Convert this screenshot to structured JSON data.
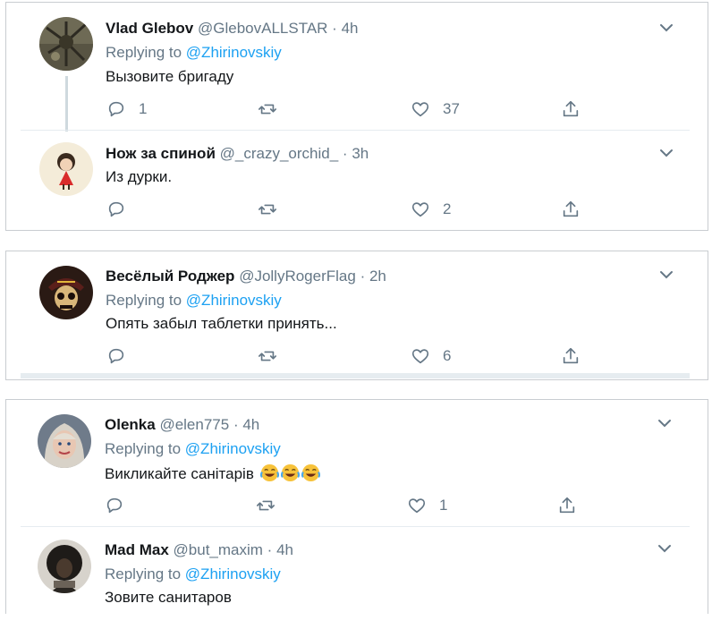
{
  "colors": {
    "link": "#1da1f2",
    "muted": "#657786",
    "text": "#14171a",
    "border": "#c9cdd1",
    "separator": "#e6ecf0"
  },
  "reply_prefix": "Replying to",
  "reply_target": "@Zhirinovskiy",
  "tweets": [
    {
      "name": "Vlad Glebov",
      "handle": "@GlebovALLSTAR",
      "dot": "·",
      "time": "4h",
      "has_reply": true,
      "text": "Вызовите бригаду",
      "replies": "1",
      "likes": "37",
      "avatar": "vlad-avatar"
    },
    {
      "name": "Нож за спиной",
      "handle": "@_crazy_orchid_",
      "dot": "·",
      "time": "3h",
      "has_reply": false,
      "text": "Из дурки.",
      "replies": "",
      "likes": "2",
      "avatar": "girl-avatar"
    },
    {
      "name": "Весёлый Роджер",
      "handle": "@JollyRogerFlag",
      "dot": "·",
      "time": "2h",
      "has_reply": true,
      "text": "Опять забыл таблетки принять...",
      "replies": "",
      "likes": "6",
      "avatar": "skull-avatar"
    },
    {
      "name": "Olenka",
      "handle": "@elen775",
      "dot": "·",
      "time": "4h",
      "has_reply": true,
      "text": "Викликайте санітарів",
      "emoji": [
        "laughing-emoji",
        "laughing-emoji",
        "laughing-emoji"
      ],
      "replies": "",
      "likes": "1",
      "avatar": "olenka-avatar"
    },
    {
      "name": "Mad Max",
      "handle": "@but_maxim",
      "dot": "·",
      "time": "4h",
      "has_reply": true,
      "text": "Зовите санитаров",
      "avatar": "madmax-avatar"
    }
  ],
  "icons": {
    "reply": "reply-icon",
    "retweet": "retweet-icon",
    "like": "heart-icon",
    "share": "share-icon",
    "menu": "chevron-down-icon"
  }
}
